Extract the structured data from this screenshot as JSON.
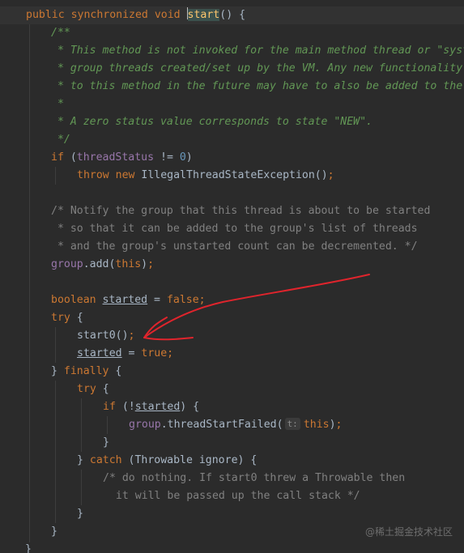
{
  "editor": {
    "l1": {
      "public": "public",
      "synchronized": "synchronized",
      "void": "void",
      "method": "start",
      "rest": "() {"
    },
    "l2": "/**",
    "l3": " * This method is not invoked for the main method thread or \"system\"",
    "l4": " * group threads created/set up by the VM. Any new functionality added",
    "l5": " * to this method in the future may have to also be added to the VM.",
    "l6": " *",
    "l7": " * A zero status value corresponds to state \"NEW\".",
    "l8": " */",
    "l9": {
      "if": "if",
      "open": " (",
      "field": "threadStatus",
      "op": " != ",
      "num": "0",
      "close": ")"
    },
    "l10": {
      "throw": "throw",
      "new": "new",
      "call": " IllegalThreadStateException()",
      "semi": ";"
    },
    "l12": "/* Notify the group that this thread is about to be started",
    "l13": " * so that it can be added to the group's list of threads",
    "l14": " * and the group's unstarted count can be decremented. */",
    "l15": {
      "field": "group",
      "call": ".add(",
      "this": "this",
      "end": ")",
      "semi": ";"
    },
    "l17": {
      "boolean": "boolean",
      "var": "started",
      "eq": " = ",
      "false": "false",
      "semi": ";"
    },
    "l18": {
      "try": "try",
      "brace": " {"
    },
    "l19": {
      "call": "start0()",
      "semi": ";"
    },
    "l20": {
      "var": "started",
      "eq": " = ",
      "true": "true",
      "semi": ";"
    },
    "l21": {
      "open": "} ",
      "finally": "finally",
      "brace": " {"
    },
    "l22": {
      "try": "try",
      "brace": " {"
    },
    "l23": {
      "if": "if",
      "open": " (!",
      "var": "started",
      "close": ") {"
    },
    "l24": {
      "field": "group",
      "call": ".threadStartFailed(",
      "hint": "t:",
      "this": "this",
      "end": ")",
      "semi": ";"
    },
    "l25": "}",
    "l26": {
      "close": "} ",
      "catch": "catch",
      "rest": " (Throwable ignore) {"
    },
    "l27": "/* do nothing. If start0 threw a Throwable then",
    "l28": "  it will be passed up the call stack */",
    "l29": "}",
    "l30": "}",
    "l31": "}"
  },
  "watermark": "@稀土掘金技术社区",
  "colors": {
    "background": "#2b2b2b",
    "keyword": "#cc7832",
    "javadoc": "#629755",
    "comment": "#808080",
    "field": "#9876aa",
    "number": "#6897bb",
    "method_declaration": "#ffc66d",
    "text": "#a9b7c6",
    "annotation_arrow": "#e0242c"
  }
}
